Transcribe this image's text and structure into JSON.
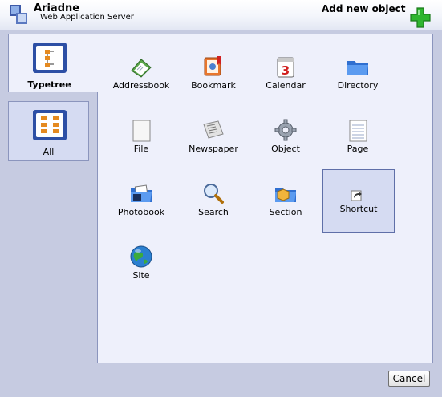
{
  "app": {
    "name": "Ariadne",
    "subtitle": "Web Application Server"
  },
  "header": {
    "title": "Add new object",
    "add_icon": "plus-icon",
    "accent": "#2fb52f"
  },
  "tabs": [
    {
      "label": "Typetree",
      "icon": "typetree-icon",
      "active": true
    },
    {
      "label": "All",
      "icon": "grid-icon",
      "active": false
    }
  ],
  "types": [
    {
      "label": "Addressbook",
      "icon": "addressbook-icon"
    },
    {
      "label": "Bookmark",
      "icon": "bookmark-icon"
    },
    {
      "label": "Calendar",
      "icon": "calendar-icon"
    },
    {
      "label": "Directory",
      "icon": "folder-icon"
    },
    {
      "label": "File",
      "icon": "file-icon"
    },
    {
      "label": "Newspaper",
      "icon": "newspaper-icon"
    },
    {
      "label": "Object",
      "icon": "gear-icon"
    },
    {
      "label": "Page",
      "icon": "page-icon"
    },
    {
      "label": "Photobook",
      "icon": "photobook-icon"
    },
    {
      "label": "Search",
      "icon": "magnifier-icon"
    },
    {
      "label": "Section",
      "icon": "section-icon"
    },
    {
      "label": "Shortcut",
      "icon": "shortcut-arrow-icon",
      "selected": true
    },
    {
      "label": "Site",
      "icon": "globe-icon"
    }
  ],
  "footer": {
    "cancel_label": "Cancel"
  }
}
